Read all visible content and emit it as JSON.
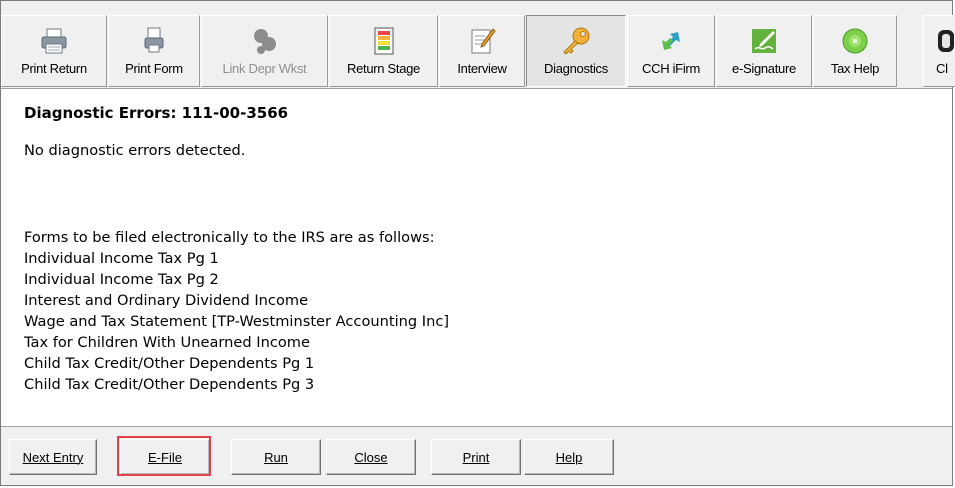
{
  "toolbar": {
    "buttons": [
      {
        "label": "Print Return",
        "icon": "printer-icon"
      },
      {
        "label": "Print Form",
        "icon": "printer-form-icon"
      },
      {
        "label": "Link Depr Wkst",
        "icon": "link-depreciation-icon"
      },
      {
        "label": "Return Stage",
        "icon": "return-stage-icon"
      },
      {
        "label": "Interview",
        "icon": "interview-icon"
      },
      {
        "label": "Diagnostics",
        "icon": "key-icon"
      },
      {
        "label": "CCH iFirm",
        "icon": "ifirm-arrows-icon"
      },
      {
        "label": "e-Signature",
        "icon": "esignature-icon"
      },
      {
        "label": "Tax Help",
        "icon": "tax-help-icon"
      },
      {
        "label": "Cl",
        "icon": "partial-icon"
      }
    ]
  },
  "content": {
    "heading": "Diagnostic Errors:  111-00-3566",
    "no_errors": "No diagnostic errors detected.",
    "efile_intro": "Forms to be filed electronically to the IRS are as follows:",
    "forms": [
      "Individual Income Tax Pg 1",
      "Individual Income Tax Pg 2",
      "Interest and Ordinary Dividend Income",
      "Wage and Tax Statement [TP-Westminster Accounting Inc]",
      "Tax for Children With Unearned Income",
      "Child Tax Credit/Other Dependents Pg 1",
      "Child Tax Credit/Other Dependents Pg 3"
    ]
  },
  "bottom": {
    "next_entry": "Next Entry",
    "efile": "E-File",
    "run": "Run",
    "close": "Close",
    "print": "Print",
    "help": "Help"
  },
  "colors": {
    "highlight": "#e0434a",
    "toolbar_bg": "#f0f0f0"
  }
}
